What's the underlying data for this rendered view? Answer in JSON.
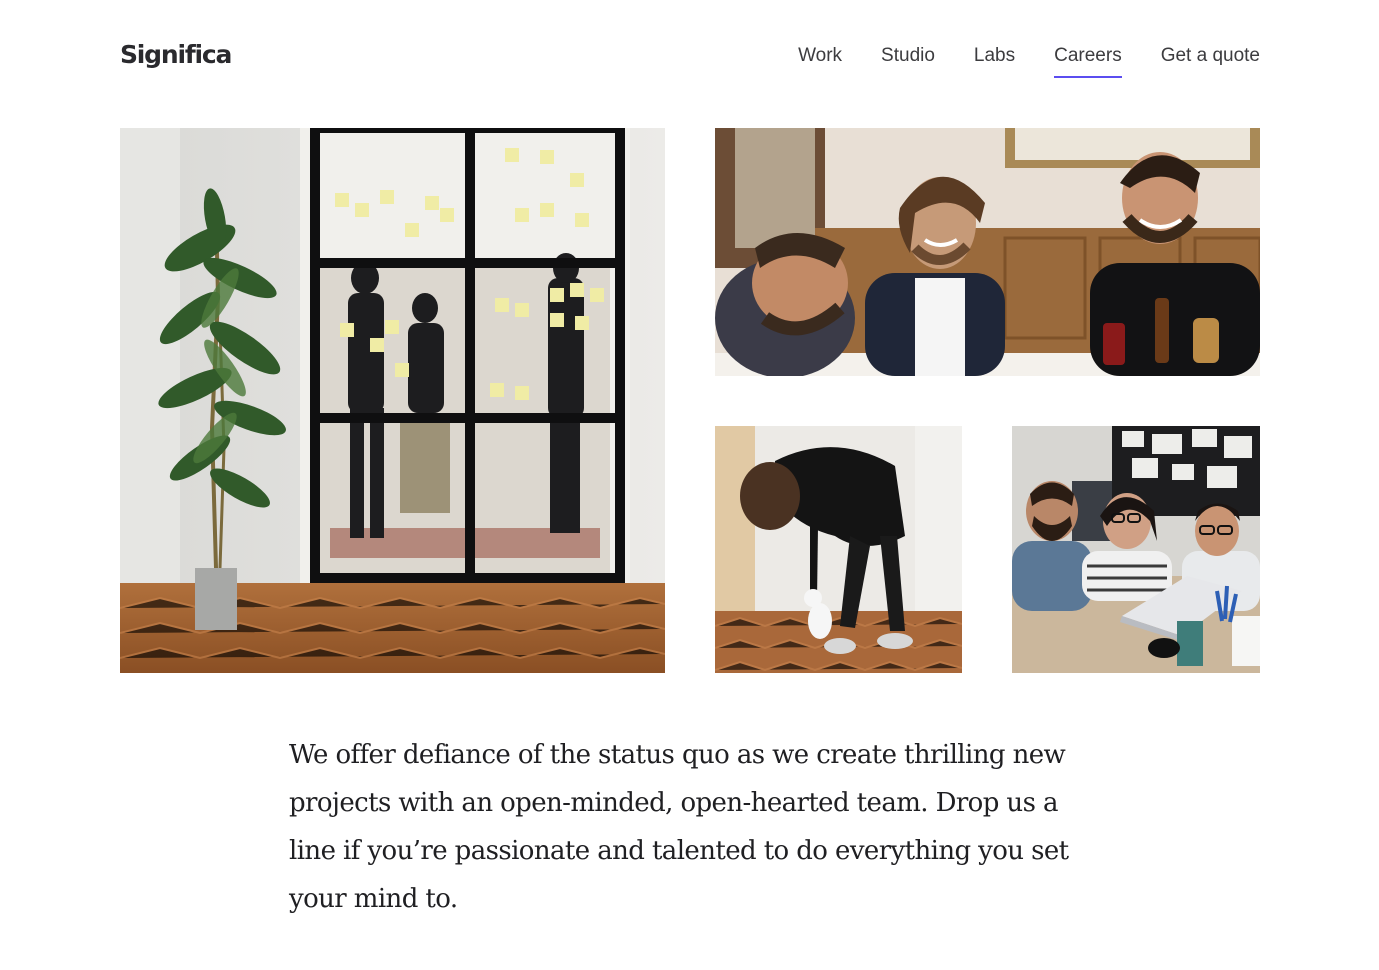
{
  "brand": {
    "logo": "Significa"
  },
  "nav": {
    "items": [
      {
        "label": "Work",
        "active": false
      },
      {
        "label": "Studio",
        "active": false
      },
      {
        "label": "Labs",
        "active": false
      },
      {
        "label": "Careers",
        "active": true
      },
      {
        "label": "Get a quote",
        "active": false
      }
    ],
    "active_underline_color": "#5b4df0"
  },
  "photos": {
    "office_glass_door": "photo of team behind glass door with sticky notes",
    "team_laughing": "photo of team members laughing at table",
    "person_with_cat": "photo of person bending to pet a white cat",
    "team_at_laptop": "photo of three people looking at a laptop"
  },
  "intro": {
    "text": "We offer defiance of the status quo as we create thrilling new projects with an open-minded, open-hearted team. Drop us a line if you’re passionate and talented to do everything you set your mind to."
  }
}
